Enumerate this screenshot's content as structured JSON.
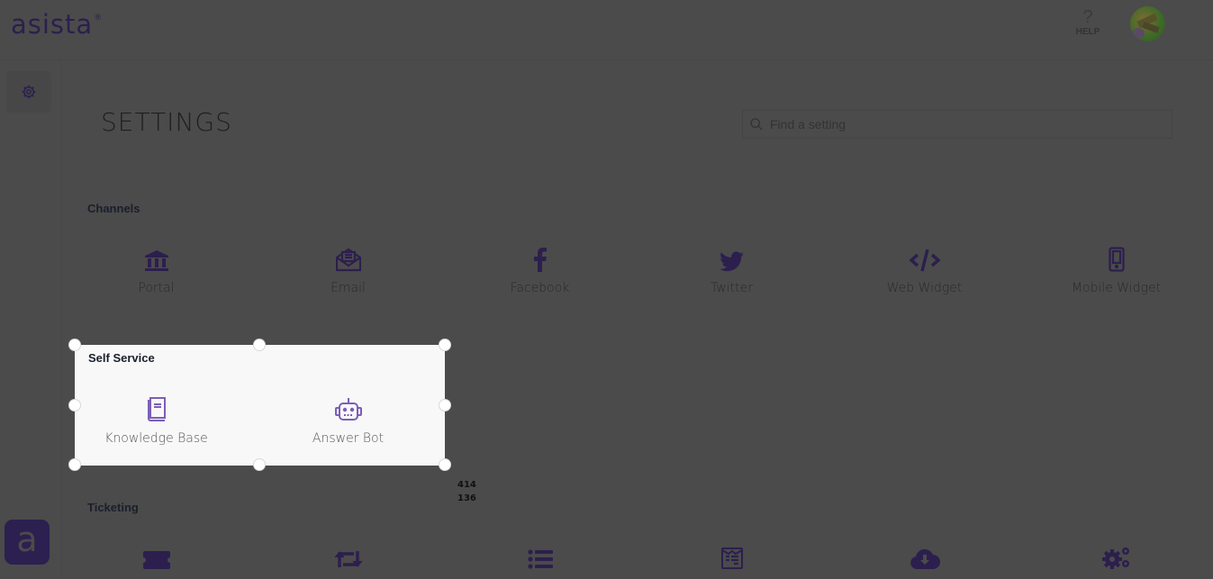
{
  "header": {
    "logo_text": "asista",
    "logo_mark": "®",
    "help_icon": "?",
    "help_label": "HELP",
    "avatar_alt": "user-avatar"
  },
  "sidebar": {
    "items": [
      {
        "name": "settings",
        "icon": "gear-icon"
      }
    ],
    "brand_button": {
      "icon": "asista-logo-icon",
      "glyph": "a"
    }
  },
  "page": {
    "title": "SETTINGS",
    "search": {
      "placeholder": "Find a setting",
      "value": ""
    }
  },
  "sections": [
    {
      "title": "Channels",
      "items": [
        {
          "label": "Portal",
          "icon": "bank-icon"
        },
        {
          "label": "Email",
          "icon": "envelope-open-icon"
        },
        {
          "label": "Facebook",
          "icon": "facebook-icon"
        },
        {
          "label": "Twitter",
          "icon": "twitter-icon"
        },
        {
          "label": "Web Widget",
          "icon": "code-icon"
        },
        {
          "label": "Mobile Widget",
          "icon": "mobile-icon"
        }
      ]
    },
    {
      "title": "Self Service",
      "items": [
        {
          "label": "Knowledge Base",
          "icon": "book-icon"
        },
        {
          "label": "Answer Bot",
          "icon": "robot-icon"
        }
      ]
    },
    {
      "title": "Ticketing",
      "items": [
        {
          "label": "",
          "icon": "ticket-icon"
        },
        {
          "label": "",
          "icon": "retweet-icon"
        },
        {
          "label": "",
          "icon": "list-icon"
        },
        {
          "label": "",
          "icon": "form-icon"
        },
        {
          "label": "",
          "icon": "cloud-download-icon"
        },
        {
          "label": "",
          "icon": "cogs-icon"
        }
      ]
    }
  ],
  "selection": {
    "width_readout": "414",
    "height_readout": "136"
  },
  "colors": {
    "overlay_bg": "#4b4b4b",
    "accent_dim": "#2c1f4e",
    "accent_active": "#7b5fb8",
    "highlight_bg": "#f8f8f8"
  }
}
